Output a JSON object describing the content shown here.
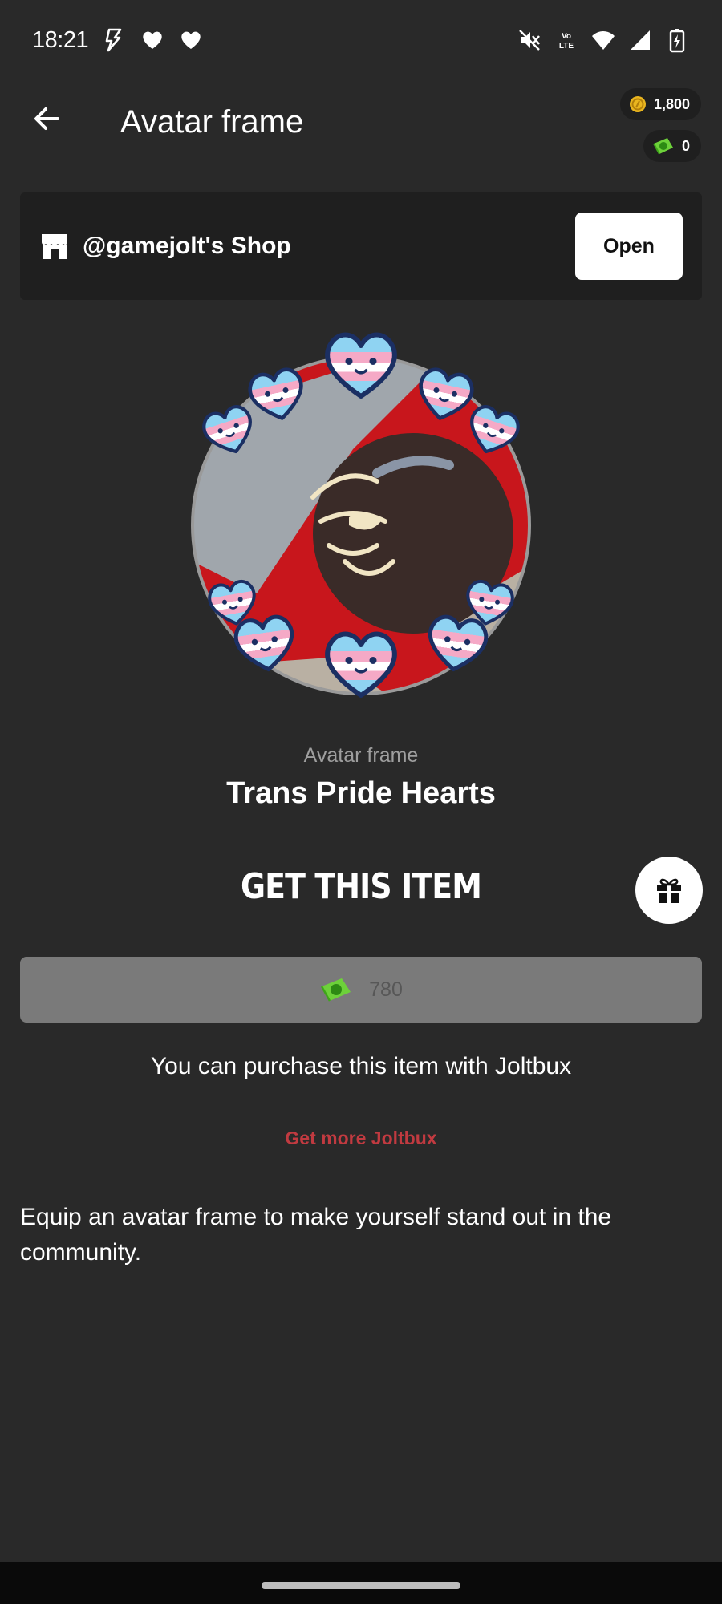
{
  "status_bar": {
    "time": "18:21",
    "left_icons": [
      "bolt-icon",
      "heart-icon",
      "heart-icon"
    ],
    "right_icons": [
      "mute-icon",
      "volte-icon",
      "wifi-icon",
      "signal-icon",
      "battery-icon"
    ]
  },
  "header": {
    "title": "Avatar frame",
    "coins_balance": "1,800",
    "joltbux_balance": "0"
  },
  "shop": {
    "name": "@gamejolt's Shop",
    "open_label": "Open"
  },
  "item": {
    "type_label": "Avatar frame",
    "name": "Trans Pride Hearts"
  },
  "purchase": {
    "heading": "GET THIS ITEM",
    "price": "780",
    "note": "You can purchase this item with Joltbux",
    "get_more_label": "Get more Joltbux"
  },
  "description": "Equip an avatar frame to make yourself stand out in the community.",
  "colors": {
    "background": "#292929",
    "card": "#1f1f1f",
    "accent_red": "#c13a40",
    "trans_blue": "#8fd3f2",
    "trans_pink": "#f5a9c6",
    "price_button": "#7a7a7a"
  }
}
